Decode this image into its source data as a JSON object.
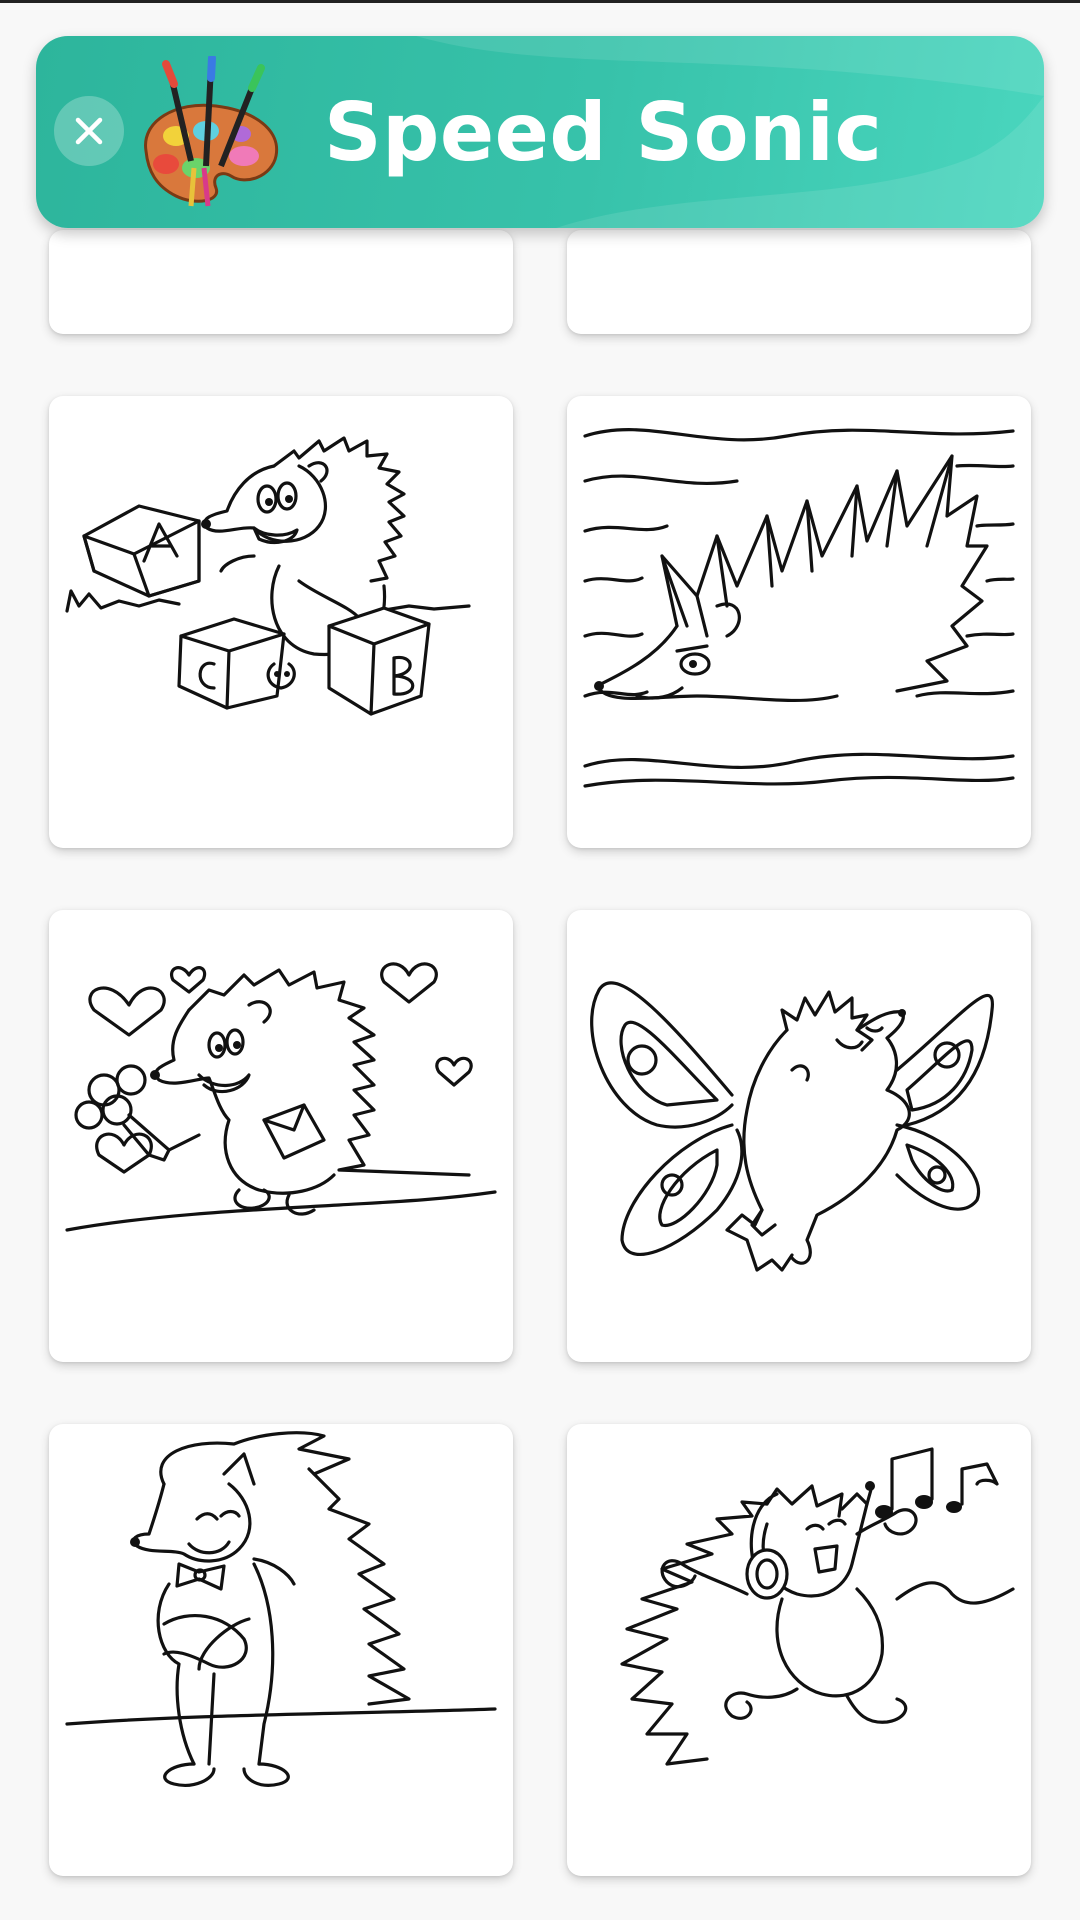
{
  "header": {
    "title": "Speed Sonic",
    "close_icon": "close-icon",
    "logo_icon": "paint-palette-icon",
    "background_color": "#35bfa6"
  },
  "gallery": {
    "items": [
      {
        "picture": "hedgehog-partial-top-left"
      },
      {
        "picture": "hedgehog-partial-top-right"
      },
      {
        "picture": "hedgehog-with-abc-blocks"
      },
      {
        "picture": "hedgehog-on-waves"
      },
      {
        "picture": "hedgehog-with-flowers-and-hearts"
      },
      {
        "picture": "hedgehog-with-butterfly-wings"
      },
      {
        "picture": "hedgehog-with-bow-tie"
      },
      {
        "picture": "hedgehog-dancing-with-headphones"
      }
    ]
  },
  "blocks_text": {
    "a": "A",
    "b": "B",
    "c": "C"
  },
  "colors": {
    "page_background": "#f8f8f8",
    "card_background": "#ffffff",
    "line_art": "#111111"
  }
}
